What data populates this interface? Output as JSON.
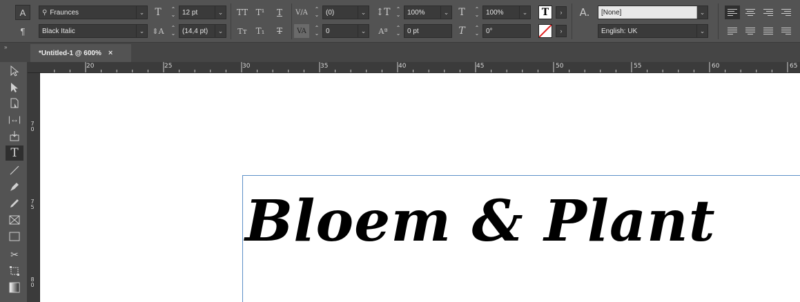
{
  "control_panel": {
    "char_mode_label": "A",
    "para_mode_label": "¶",
    "font_family": "Fraunces",
    "font_style": "Black Italic",
    "font_size": "12 pt",
    "leading": "(14,4 pt)",
    "kerning": "(0)",
    "tracking": "0",
    "vertical_scale": "100%",
    "horizontal_scale": "100%",
    "baseline_shift": "0 pt",
    "skew": "0°",
    "char_style": "[None]",
    "language": "English: UK",
    "fill_swatch_label": "T"
  },
  "tab": {
    "title": "*Untitled-1 @ 600%",
    "close_label": "×"
  },
  "ruler": {
    "h_numbers": [
      "20",
      "25",
      "30",
      "35",
      "40",
      "45",
      "50",
      "55",
      "60",
      "65"
    ],
    "v_numbers": [
      [
        "7",
        "0"
      ],
      [
        "7",
        "5"
      ],
      [
        "8",
        "0"
      ]
    ]
  },
  "canvas": {
    "headline": "Bloem & Plant"
  }
}
